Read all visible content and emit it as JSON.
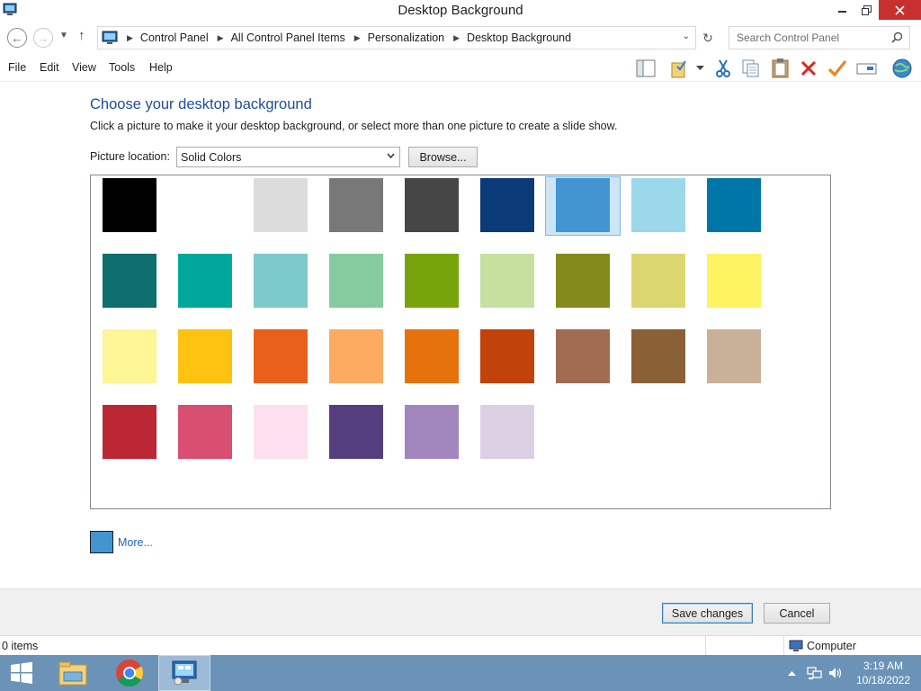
{
  "window": {
    "title": "Desktop Background"
  },
  "nav": {
    "breadcrumb": [
      "Control Panel",
      "All Control Panel Items",
      "Personalization",
      "Desktop Background"
    ],
    "search_placeholder": "Search Control Panel"
  },
  "menu": [
    "File",
    "Edit",
    "View",
    "Tools",
    "Help"
  ],
  "toolbar_icons": [
    "layout-pane-icon",
    "folder-properties-icon",
    "cut-icon",
    "copy-icon",
    "paste-icon",
    "delete-icon",
    "checkmark-icon",
    "rename-icon",
    "globe-icon"
  ],
  "content": {
    "heading": "Choose your desktop background",
    "subtext": "Click a picture to make it your desktop background, or select more than one picture to create a slide show.",
    "location_label": "Picture location:",
    "location_value": "Solid Colors",
    "browse_label": "Browse...",
    "more_label": "More...",
    "more_color": "#4295d1",
    "selected_index": 6,
    "swatches": [
      "#000000",
      "#ffffff",
      "#dcdcdc",
      "#787878",
      "#464646",
      "#0a3a78",
      "#4295d1",
      "#9bd8ea",
      "#0076a8",
      "#0f6e6e",
      "#00a89b",
      "#7ccbca",
      "#86cb9f",
      "#78a40b",
      "#c5e09f",
      "#858a1c",
      "#dcd670",
      "#fef462",
      "#fef595",
      "#fec211",
      "#e9601d",
      "#fbac60",
      "#e5720d",
      "#c1430a",
      "#a16c51",
      "#8a6137",
      "#c9b099",
      "#bc2736",
      "#d84f72",
      "#fde0ef",
      "#563f7f",
      "#a187be",
      "#dcd0e5"
    ]
  },
  "footer": {
    "save_label": "Save changes",
    "cancel_label": "Cancel"
  },
  "status": {
    "items": "0 items",
    "location": "Computer"
  },
  "taskbar": {
    "time": "3:19 AM",
    "date": "10/18/2022"
  }
}
